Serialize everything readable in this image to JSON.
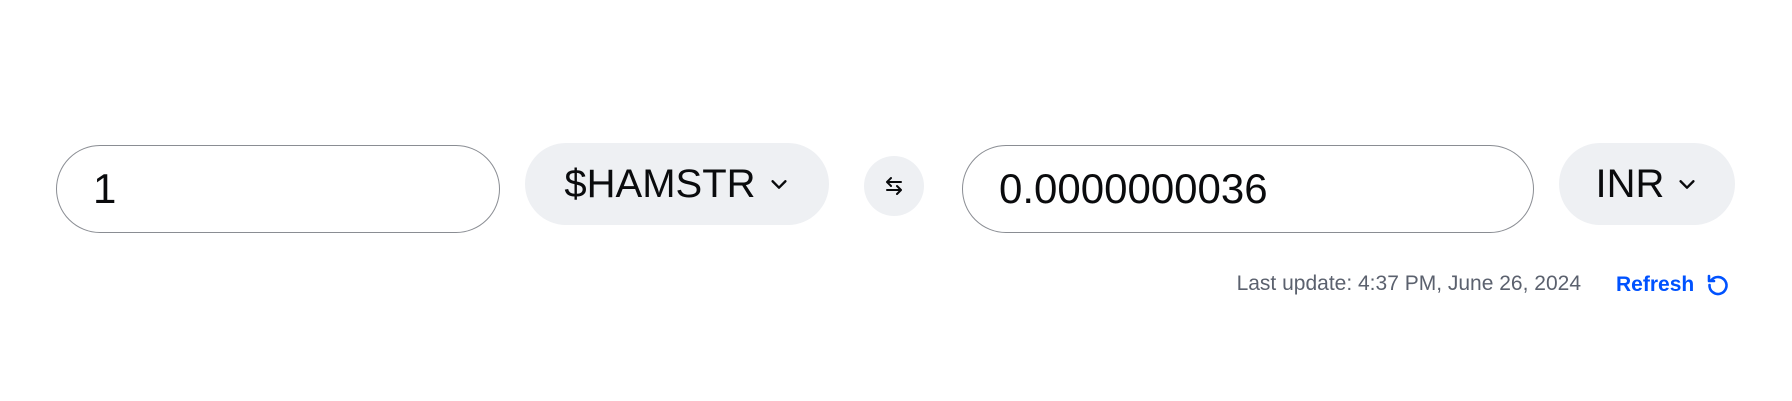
{
  "converter": {
    "from_amount": "1",
    "from_currency": "$HAMSTR",
    "to_amount": "0.0000000036",
    "to_currency": "INR"
  },
  "status": {
    "last_update": "Last update: 4:37 PM, June 26, 2024",
    "refresh_label": "Refresh"
  },
  "icons": {
    "from_currency_chevron": "chevron-down-icon",
    "to_currency_chevron": "chevron-down-icon",
    "swap": "swap-arrows-icon",
    "refresh": "refresh-icon"
  },
  "colors": {
    "text": "#0a0b0d",
    "secondary_text": "#5b616e",
    "pill_background": "#eef0f3",
    "field_border": "#8a8d93",
    "accent": "#0052ff"
  }
}
